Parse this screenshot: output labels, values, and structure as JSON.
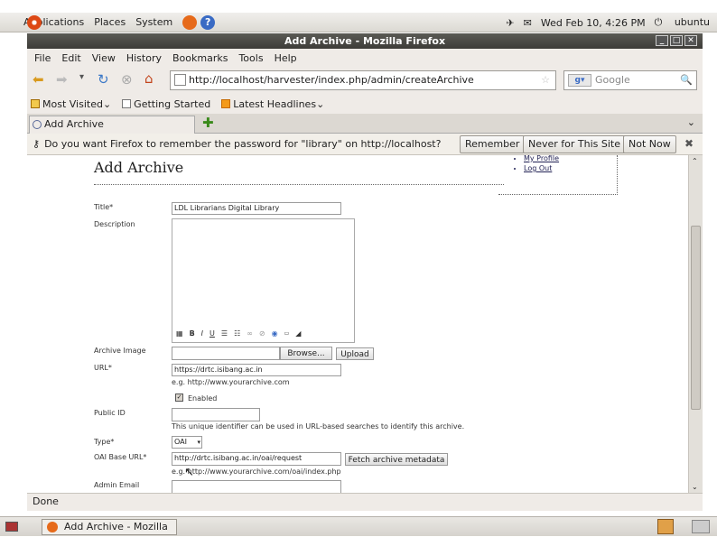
{
  "top_panel": {
    "applications": "Applications",
    "places": "Places",
    "system": "System",
    "datetime": "Wed Feb 10,  4:26 PM",
    "user": "ubuntu"
  },
  "window": {
    "title": "Add Archive - Mozilla Firefox"
  },
  "menubar": {
    "file": "File",
    "edit": "Edit",
    "view": "View",
    "history": "History",
    "bookmarks": "Bookmarks",
    "tools": "Tools",
    "help": "Help"
  },
  "navbar": {
    "url": "http://localhost/harvester/index.php/admin/createArchive",
    "search_placeholder": "Google"
  },
  "bookmarks_bar": {
    "most_visited": "Most Visited",
    "getting_started": "Getting Started",
    "latest_headlines": "Latest Headlines"
  },
  "tab": {
    "title": "Add Archive"
  },
  "notification": {
    "message": "Do you want Firefox to remember the password for \"library\" on http://localhost?",
    "remember": "Remember",
    "never": "Never for This Site",
    "not_now": "Not Now"
  },
  "page": {
    "title": "Add Archive",
    "sidebar_links": [
      "My Profile",
      "Log Out"
    ],
    "form": {
      "title_label": "Title*",
      "title_value": "LDL Librarians Digital Library",
      "description_label": "Description",
      "archive_image_label": "Archive Image",
      "browse": "Browse...",
      "upload": "Upload",
      "url_label": "URL*",
      "url_value": "https://drtc.isibang.ac.in",
      "url_hint": "e.g. http://www.yourarchive.com",
      "enabled_label": "Enabled",
      "public_id_label": "Public ID",
      "public_id_hint": "This unique identifier can be used in URL-based searches to identify this archive.",
      "type_label": "Type*",
      "type_value": "OAI",
      "oai_label": "OAI Base URL*",
      "oai_value": "http://drtc.isibang.ac.in/oai/request",
      "fetch": "Fetch archive metadata",
      "oai_hint": "e.g. http://www.yourarchive.com/oai/index.php",
      "admin_email_label": "Admin Email"
    }
  },
  "statusbar": {
    "text": "Done"
  },
  "taskbar": {
    "item": "Add Archive - Mozilla F..."
  }
}
